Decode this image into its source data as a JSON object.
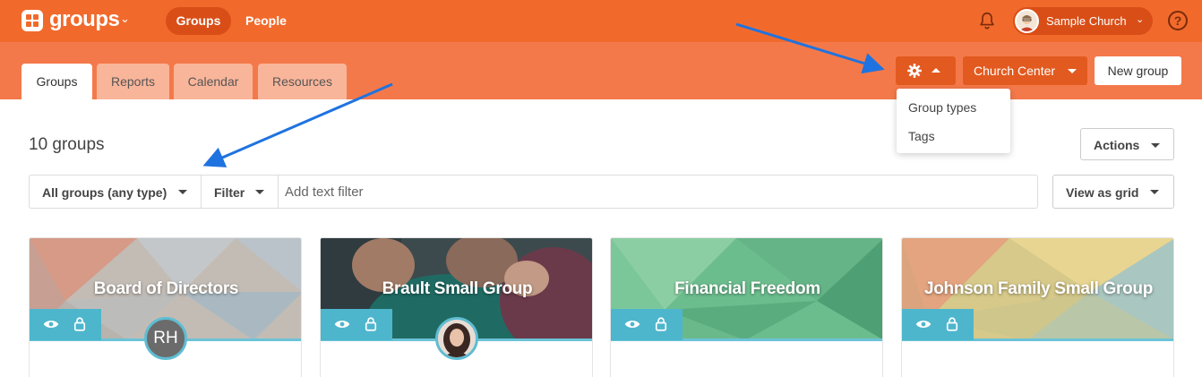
{
  "header": {
    "brand": "groups",
    "nav": [
      {
        "label": "Groups"
      },
      {
        "label": "People"
      }
    ],
    "account_name": "Sample Church",
    "help_glyph": "?"
  },
  "tabs": [
    {
      "label": "Groups"
    },
    {
      "label": "Reports"
    },
    {
      "label": "Calendar"
    },
    {
      "label": "Resources"
    }
  ],
  "toolbar": {
    "church_center_label": "Church Center",
    "new_group_label": "New group"
  },
  "settings_menu": {
    "items": [
      {
        "label": "Group types"
      },
      {
        "label": "Tags"
      }
    ]
  },
  "main": {
    "group_count": "10 groups",
    "actions_label": "Actions",
    "filter": {
      "type_select": "All groups (any type)",
      "filter_label": "Filter",
      "text_placeholder": "Add text filter"
    },
    "view_label": "View as grid"
  },
  "cards": [
    {
      "title": "Board of Directors",
      "avatar_initials": "RH"
    },
    {
      "title": "Brault Small Group"
    },
    {
      "title": "Financial Freedom"
    },
    {
      "title": "Johnson Family Small Group"
    }
  ],
  "colors": {
    "brand_orange": "#f16a2c",
    "sub_orange": "#f4794a",
    "accent_teal": "#4db6cc",
    "annotation_arrow": "#1f73e0"
  }
}
